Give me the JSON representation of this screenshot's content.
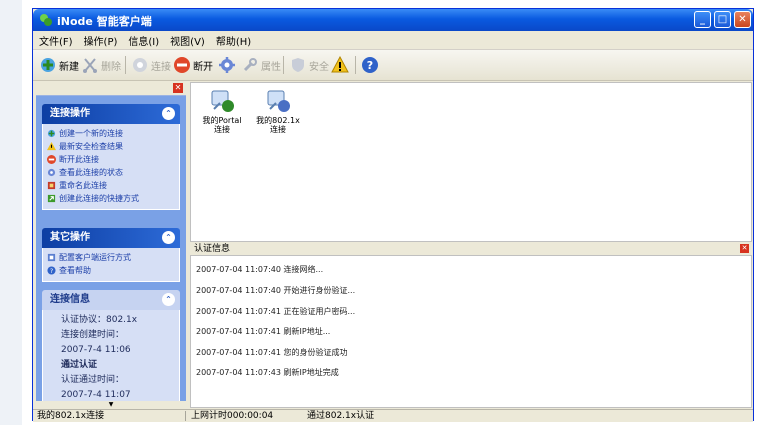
{
  "window": {
    "title": "iNode 智能客户端"
  },
  "menu": [
    "文件(F)",
    "操作(P)",
    "信息(I)",
    "视图(V)",
    "帮助(H)"
  ],
  "toolbar": {
    "new_label": "新建",
    "delete_label": "删除",
    "connect_label": "连接",
    "disconnect_label": "断开",
    "property_label": "属性",
    "security_label": "安全"
  },
  "tasks_panel": {
    "title": "连接操作",
    "items": [
      "创建一个新的连接",
      "最新安全检查结果",
      "断开此连接",
      "查看此连接的状态",
      "重命名此连接",
      "创建此连接的快捷方式"
    ]
  },
  "other_panel": {
    "title": "其它操作",
    "items": [
      "配置客户端运行方式",
      "查看帮助"
    ]
  },
  "info_panel": {
    "title": "连接信息",
    "lines": [
      "认证协议：802.1x",
      "连接创建时间：",
      "2007-7-4 11:06",
      "通过认证",
      "认证通过时间：",
      "2007-7-4 11:07"
    ]
  },
  "connections": [
    {
      "line1": "我的Portal",
      "line2": "连接"
    },
    {
      "line1": "我的802.1x",
      "line2": "连接"
    }
  ],
  "log": {
    "title": "认证信息",
    "lines": [
      "2007-07-04 11:07:40 连接网络...",
      "2007-07-04 11:07:40 开始进行身份验证...",
      "2007-07-04 11:07:41 正在验证用户密码...",
      "2007-07-04 11:07:41 刷新IP地址...",
      "2007-07-04 11:07:41 您的身份验证成功",
      "2007-07-04 11:07:43 刷新IP地址完成"
    ]
  },
  "status": {
    "left": "我的802.1x连接",
    "middle": "上网计时000:00:04",
    "right": "通过802.1x认证"
  },
  "colors": {
    "titlebar": "#0a5ae0",
    "taskpane": "#7aa1e6",
    "panel_head": "#0d3ea3",
    "link": "#1c3fa8"
  }
}
